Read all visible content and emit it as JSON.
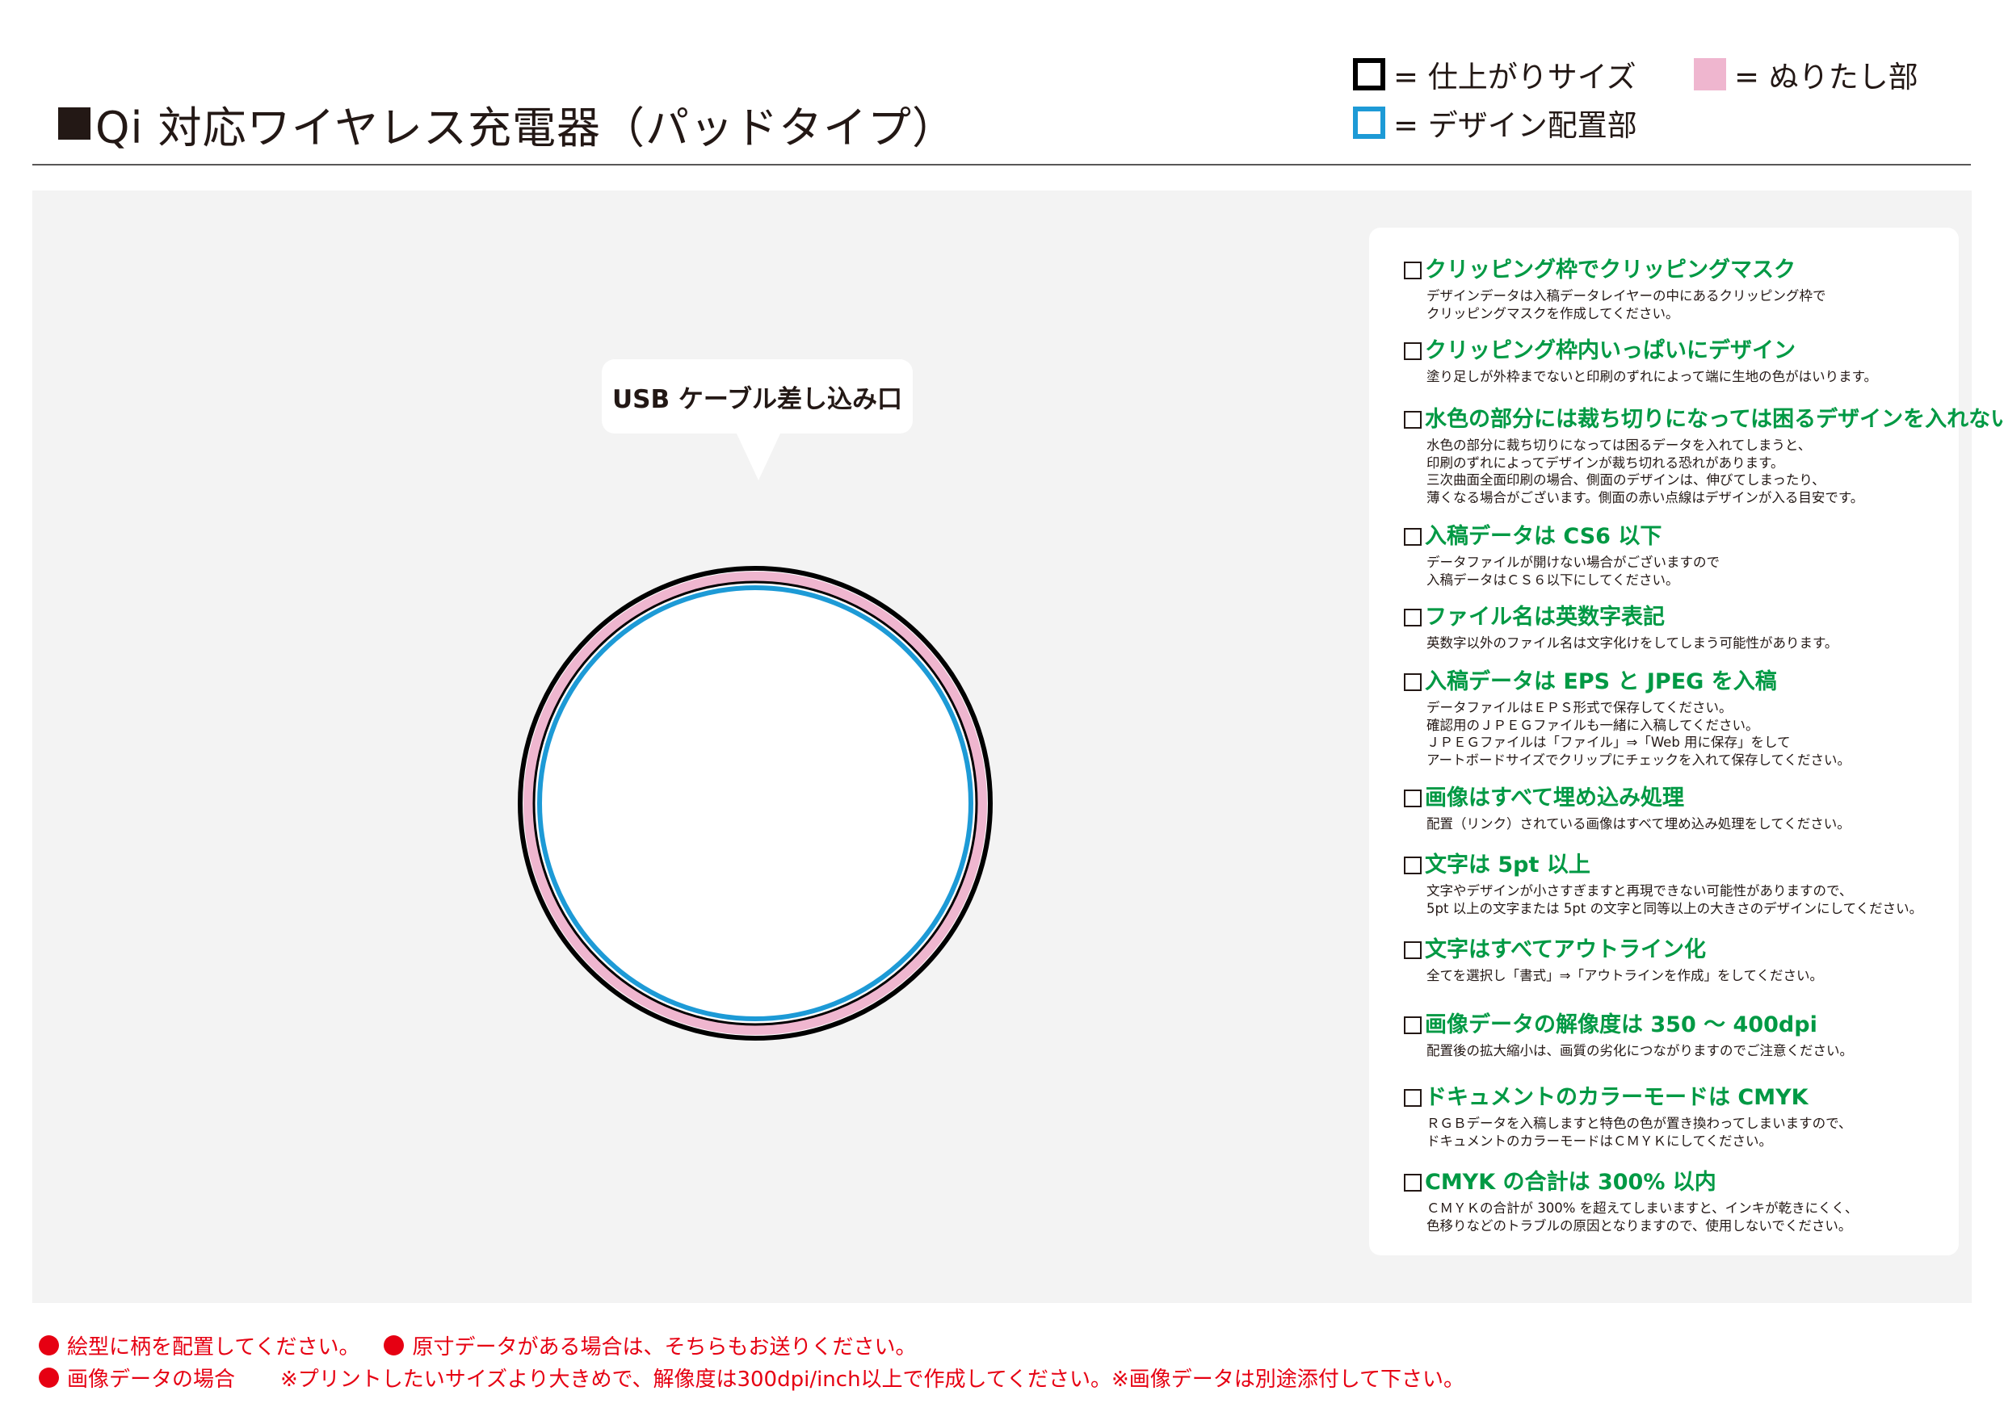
{
  "header": {
    "title": "Qi 対応ワイヤレス充電器（パッドタイプ）"
  },
  "legend": {
    "finish_size": "= 仕上がりサイズ",
    "design_area": "= デザイン配置部",
    "paint_area": "= ぬりたし部",
    "colors": {
      "finish": "#000000",
      "design": "#1d9ad6",
      "paint": "#efb6cf"
    }
  },
  "artboard": {
    "callout": "USB ケーブル差し込み口"
  },
  "checklist": [
    {
      "title": "クリッピング枠でクリッピングマスク",
      "body": "デザインデータは入稿データレイヤーの中にあるクリッピング枠で\nクリッピングマスクを作成してください。"
    },
    {
      "title": "クリッピング枠内いっぱいにデザイン",
      "body": "塗り足しが外枠までないと印刷のずれによって端に生地の色がはいります。"
    },
    {
      "title": "水色の部分には裁ち切りになっては困るデザインを入れない",
      "body": "水色の部分に裁ち切りになっては困るデータを入れてしまうと、\n印刷のずれによってデザインが裁ち切れる恐れがあります。\n三次曲面全面印刷の場合、側面のデザインは、伸びてしまったり、\n薄くなる場合がございます。側面の赤い点線はデザインが入る目安です。"
    },
    {
      "title": "入稿データは CS6 以下",
      "body": "データファイルが開けない場合がございますので\n入稿データはＣＳ６以下にしてください。"
    },
    {
      "title": "ファイル名は英数字表記",
      "body": "英数字以外のファイル名は文字化けをしてしまう可能性があります。"
    },
    {
      "title": "入稿データは EPS と JPEG を入稿",
      "body": "データファイルはＥＰＳ形式で保存してください。\n確認用のＪＰＥＧファイルも一緒に入稿してください。\nＪＰＥＧファイルは「ファイル」⇒「Web 用に保存」をして\nアートボードサイズでクリップにチェックを入れて保存してください。"
    },
    {
      "title": "画像はすべて埋め込み処理",
      "body": "配置（リンク）されている画像はすべて埋め込み処理をしてください。"
    },
    {
      "title": "文字は 5pt 以上",
      "body": "文字やデザインが小さすぎますと再現できない可能性がありますので、\n5pt 以上の文字または 5pt の文字と同等以上の大きさのデザインにしてください。"
    },
    {
      "title": "文字はすべてアウトライン化",
      "body": "全てを選択し「書式」⇒「アウトラインを作成」をしてください。"
    },
    {
      "title": "画像データの解像度は 350 〜 400dpi",
      "body": "配置後の拡大縮小は、画質の劣化につながりますのでご注意ください。"
    },
    {
      "title": "ドキュメントのカラーモードは CMYK",
      "body": "ＲＧＢデータを入稿しますと特色の色が置き換わってしまいますので、\nドキュメントのカラーモードはＣＭＹＫにしてください。"
    },
    {
      "title": "CMYK の合計は 300% 以内",
      "body": "ＣＭＹＫの合計が 300% を超えてしまいますと、インキが乾きにくく、\n色移りなどのトラブルの原因となりますので、使用しないでください。"
    }
  ],
  "footer": {
    "line1_a": "絵型に柄を配置してください。",
    "line1_b": "原寸データがある場合は、そちらもお送りください。",
    "line2_label": "画像データの場合",
    "line2_text": "※プリントしたいサイズより大きめで、解像度は300dpi/inch以上で作成してください。※画像データは別途添付して下さい。",
    "accent": "#e60012"
  }
}
